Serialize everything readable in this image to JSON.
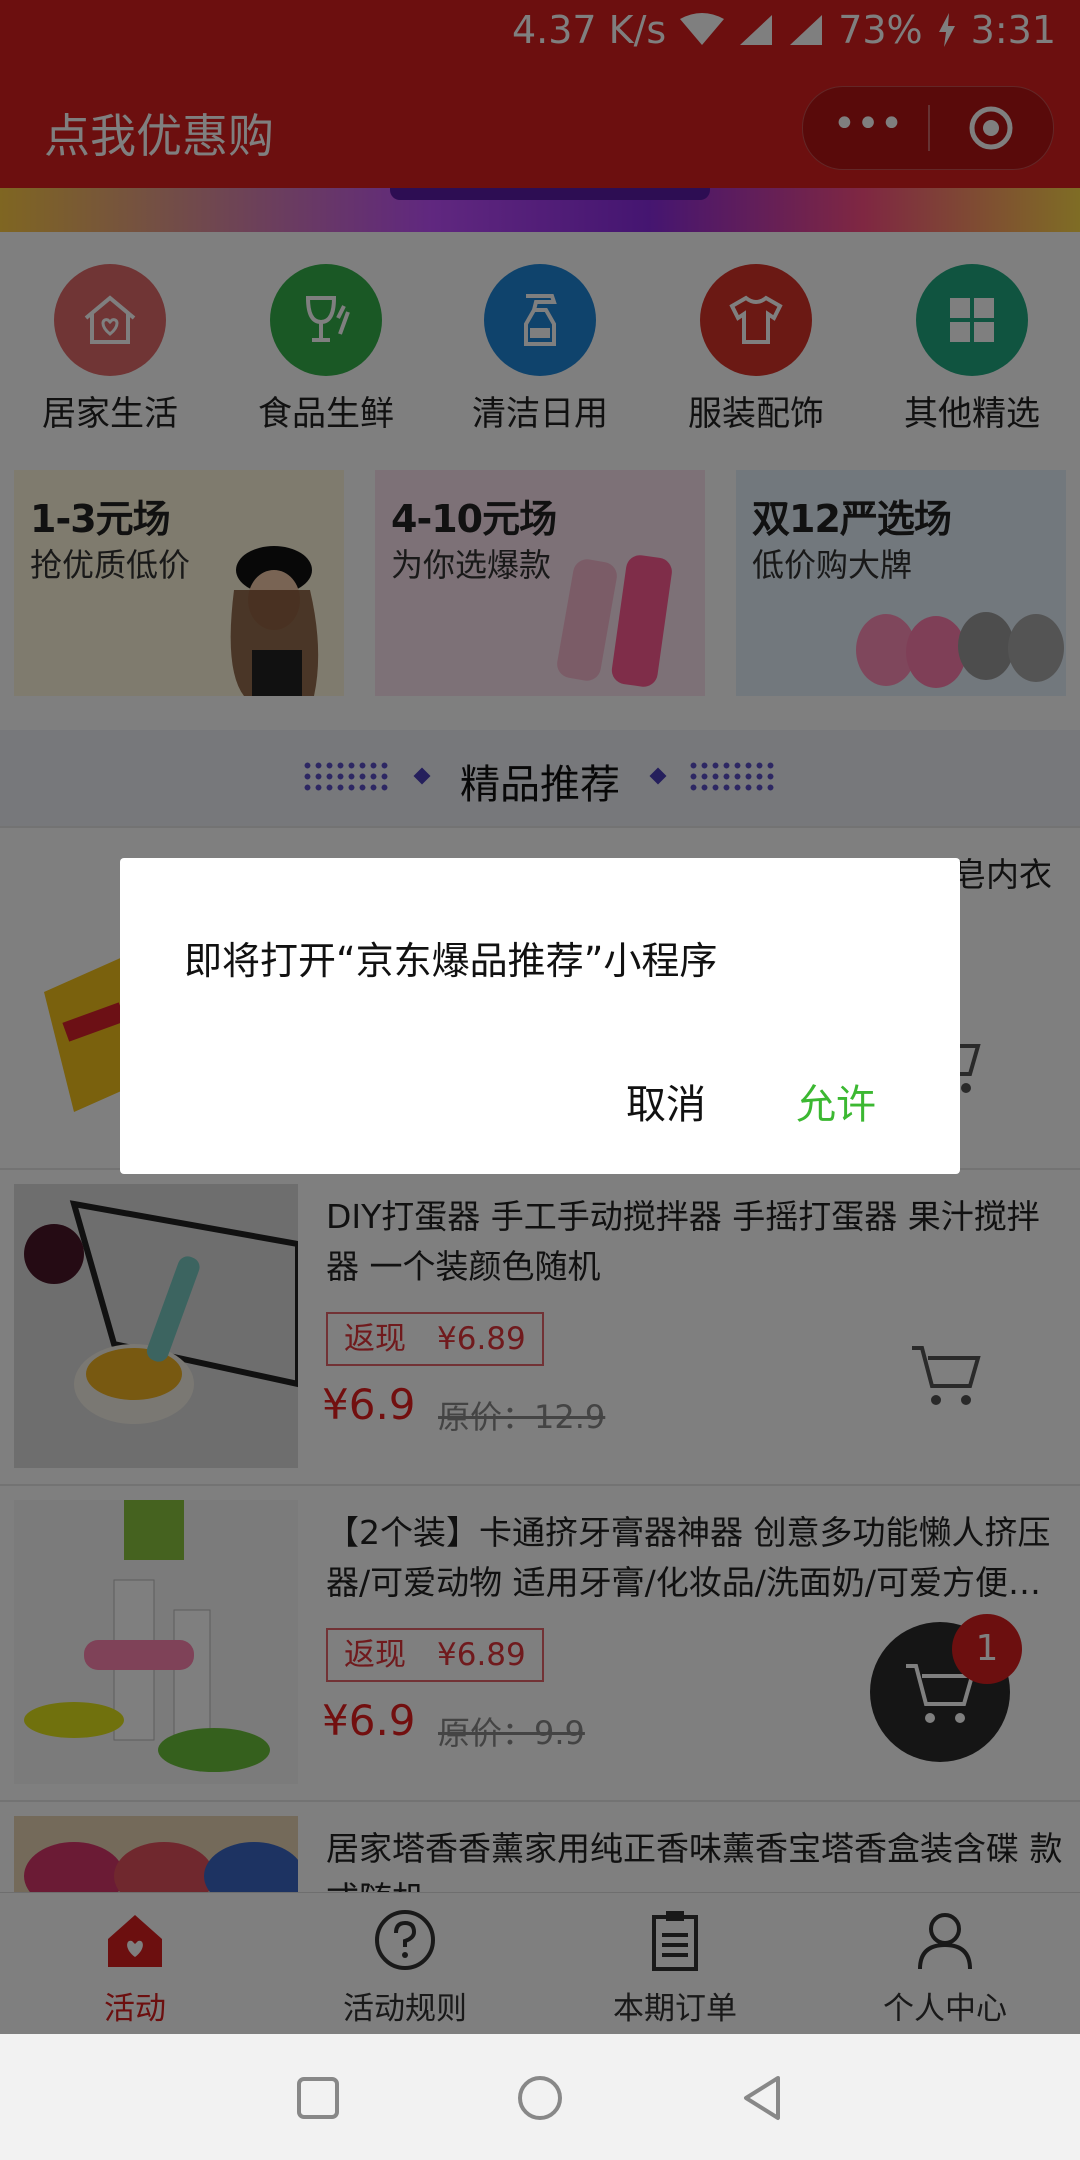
{
  "status_bar": {
    "speed": "4.37 K/s",
    "battery": "73%",
    "time": "3:31"
  },
  "header": {
    "title": "点我优惠购"
  },
  "categories": [
    {
      "label": "居家生活",
      "icon": "house-heart-icon",
      "color": "#e06b6b"
    },
    {
      "label": "食品生鲜",
      "icon": "wine-glass-icon",
      "color": "#35b04b"
    },
    {
      "label": "清洁日用",
      "icon": "spray-bottle-icon",
      "color": "#1f86d8"
    },
    {
      "label": "服装配饰",
      "icon": "tshirt-icon",
      "color": "#d63228"
    },
    {
      "label": "其他精选",
      "icon": "grid-icon",
      "color": "#20a880"
    }
  ],
  "promos": [
    {
      "title": "1-3元场",
      "subtitle": "抢优质低价"
    },
    {
      "title": "4-10元场",
      "subtitle": "为你选爆款"
    },
    {
      "title": "双12严选场",
      "subtitle": "低价购大牌"
    }
  ],
  "section": {
    "label": "精品推荐"
  },
  "products": [
    {
      "name": "…皂内衣药",
      "cashback": "",
      "price": "",
      "original": ""
    },
    {
      "name": "DIY打蛋器 手工手动搅拌器 手摇打蛋器 果汁搅拌器 一个装颜色随机",
      "cashback": "返现　¥6.89",
      "price": "¥6.9",
      "original": "原价：12.9"
    },
    {
      "name": "【2个装】卡通挤牙膏器神器 创意多功能懒人挤压器/可爱动物 适用牙膏/化妆品/洗面奶/可爱方便…",
      "cashback": "返现　¥6.89",
      "price": "¥6.9",
      "original": "原价：9.9"
    },
    {
      "name": "居家塔香香薰家用纯正香味薰香宝塔香盒装含碟 款式随机",
      "cashback": "",
      "price": "",
      "original": ""
    }
  ],
  "cart_badge": "1",
  "tabbar": [
    {
      "label": "活动",
      "icon": "home-heart-icon",
      "active": true
    },
    {
      "label": "活动规则",
      "icon": "question-circle-icon",
      "active": false
    },
    {
      "label": "本期订单",
      "icon": "clipboard-icon",
      "active": false
    },
    {
      "label": "个人中心",
      "icon": "user-icon",
      "active": false
    }
  ],
  "dialog": {
    "message": "即将打开“京东爆品推荐”小程序",
    "cancel_label": "取消",
    "allow_label": "允许"
  },
  "colors": {
    "brand_red": "#d81e1e",
    "allow_green": "#3cb832"
  }
}
